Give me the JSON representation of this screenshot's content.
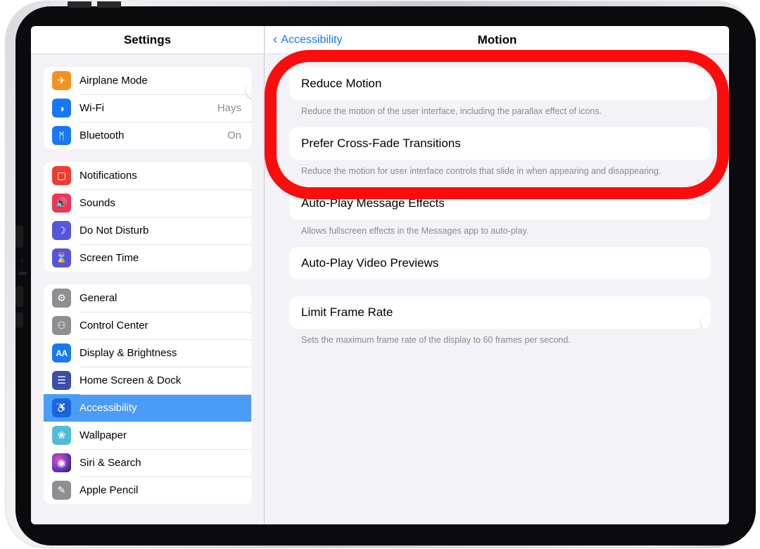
{
  "sidebar": {
    "title": "Settings",
    "groups": [
      {
        "items": [
          {
            "label": "Airplane Mode",
            "icon": "airplane-icon",
            "glyph": "✈",
            "control": "toggle",
            "state": "off"
          },
          {
            "label": "Wi-Fi",
            "icon": "wifi-icon",
            "glyph": "◑",
            "control": "value",
            "value": "Hays"
          },
          {
            "label": "Bluetooth",
            "icon": "bluetooth-icon",
            "glyph": "ᛗ",
            "control": "value",
            "value": "On"
          }
        ]
      },
      {
        "items": [
          {
            "label": "Notifications",
            "icon": "notifications-icon",
            "glyph": "▢",
            "control": "none"
          },
          {
            "label": "Sounds",
            "icon": "sounds-icon",
            "glyph": "🔊",
            "control": "none"
          },
          {
            "label": "Do Not Disturb",
            "icon": "moon-icon",
            "glyph": "☽",
            "control": "none"
          },
          {
            "label": "Screen Time",
            "icon": "hourglass-icon",
            "glyph": "⌛",
            "control": "none"
          }
        ]
      },
      {
        "items": [
          {
            "label": "General",
            "icon": "gear-icon",
            "glyph": "⚙",
            "control": "none"
          },
          {
            "label": "Control Center",
            "icon": "control-center-icon",
            "glyph": "⚇",
            "control": "none"
          },
          {
            "label": "Display & Brightness",
            "icon": "display-brightness-icon",
            "glyph": "AA",
            "control": "none"
          },
          {
            "label": "Home Screen & Dock",
            "icon": "home-screen-dock-icon",
            "glyph": "☰",
            "control": "none"
          },
          {
            "label": "Accessibility",
            "icon": "accessibility-icon",
            "glyph": "♿",
            "control": "none",
            "selected": true
          },
          {
            "label": "Wallpaper",
            "icon": "wallpaper-icon",
            "glyph": "❀",
            "control": "none"
          },
          {
            "label": "Siri & Search",
            "icon": "siri-icon",
            "glyph": "◉",
            "control": "none"
          },
          {
            "label": "Apple Pencil",
            "icon": "apple-pencil-icon",
            "glyph": "✎",
            "control": "none"
          }
        ]
      }
    ]
  },
  "content": {
    "back_label": "Accessibility",
    "back_chevron": "‹",
    "title": "Motion",
    "blocks": [
      {
        "rows": [
          {
            "label": "Reduce Motion",
            "state": "on"
          }
        ],
        "footnote": "Reduce the motion of the user interface, including the parallax effect of icons."
      },
      {
        "rows": [
          {
            "label": "Prefer Cross-Fade Transitions",
            "state": "on"
          }
        ],
        "footnote": "Reduce the motion for user interface controls that slide in when appearing and disappearing."
      },
      {
        "rows": [
          {
            "label": "Auto-Play Message Effects",
            "state": "on"
          }
        ],
        "footnote": "Allows fullscreen effects in the Messages app to auto-play."
      },
      {
        "rows": [
          {
            "label": "Auto-Play Video Previews",
            "state": "on"
          }
        ],
        "footnote": ""
      },
      {
        "rows": [
          {
            "label": "Limit Frame Rate",
            "state": "off"
          }
        ],
        "footnote": "Sets the maximum frame rate of the display to 60 frames per second."
      }
    ]
  },
  "annotation": {
    "type": "highlight-oval",
    "color": "#fb0d0d",
    "targets": [
      "Reduce Motion",
      "Prefer Cross-Fade Transitions"
    ]
  },
  "colors": {
    "accent_blue": "#1878f3",
    "selected_row": "#4a9cf6",
    "toggle_on": "#34c759",
    "toggle_off": "#e6e6ea",
    "list_background": "#f2f2f7",
    "card_background": "#ffffff",
    "annotation_red": "#fb0d0d"
  }
}
